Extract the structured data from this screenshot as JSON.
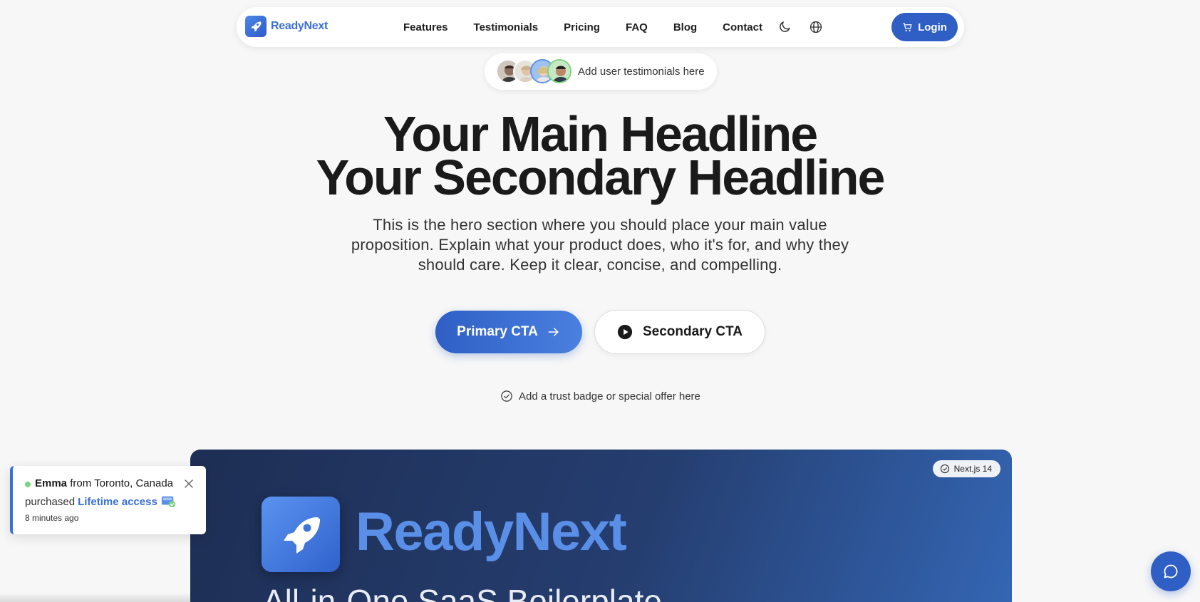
{
  "nav": {
    "logo_text": "ReadyNext",
    "links": [
      "Features",
      "Testimonials",
      "Pricing",
      "FAQ",
      "Blog",
      "Contact"
    ],
    "login_label": "Login"
  },
  "testimonials_pill": {
    "text": "Add user testimonials here"
  },
  "hero": {
    "headline_main": "Your Main Headline",
    "headline_secondary": "Your Secondary Headline",
    "subtext": "This is the hero section where you should place your main value proposition. Explain what your product does, who it's for, and why they should care. Keep it clear, concise, and compelling.",
    "primary_cta": "Primary CTA",
    "secondary_cta": "Secondary CTA",
    "trust_badge": "Add a trust badge or special offer here"
  },
  "preview": {
    "badge": "Next.js 14",
    "logo_text": "ReadyNext",
    "tagline": "All-in-One SaaS Boilerplate"
  },
  "notification": {
    "name": "Emma",
    "location_text": "from Toronto, Canada",
    "purchased_text": "purchased",
    "product_link": "Lifetime access",
    "time": "8 minutes ago"
  },
  "colors": {
    "accent": "#2f5fc4",
    "background": "#f7f7f7",
    "status_dot": "#7bd47f"
  },
  "icons": [
    "rocket-icon",
    "moon-icon",
    "globe-icon",
    "cart-icon",
    "arrow-right-icon",
    "play-icon",
    "check-circle-icon",
    "close-icon",
    "chat-icon",
    "gift-icon"
  ]
}
